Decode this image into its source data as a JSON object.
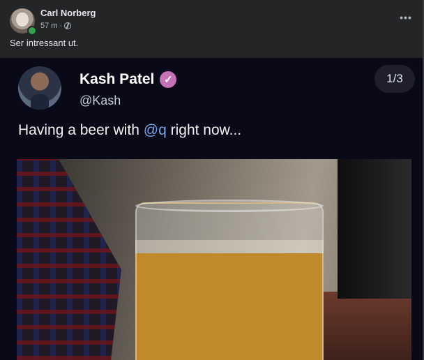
{
  "post": {
    "author": "Carl Norberg",
    "time": "57 m ·",
    "caption": "Ser intressant ut.",
    "more_label": "•••"
  },
  "tweet": {
    "name": "Kash Patel",
    "handle": "@Kash",
    "counter": "1/3",
    "text_before": "Having a beer with ",
    "mention": "@q",
    "text_after": " right now..."
  },
  "colors": {
    "accent_verified": "#c471b6",
    "mention": "#74a7e6",
    "online": "#31a24c"
  }
}
